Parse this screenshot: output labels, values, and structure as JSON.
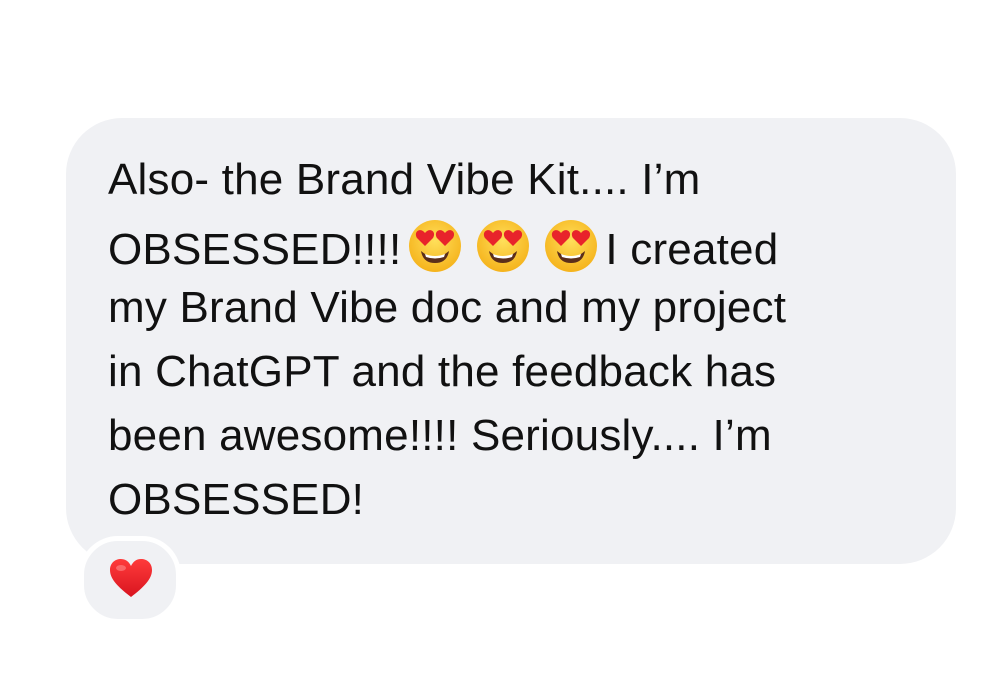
{
  "message": {
    "line1": "Also- the Brand  Vibe Kit.... I’m",
    "line2_before": "OBSESSED!!!!",
    "line2_after": "I created",
    "line3": "my Brand Vibe doc and my project",
    "line4": "in ChatGPT and the feedback has",
    "line5": "been awesome!!!! Seriously.... I’m",
    "line6": "OBSESSED!",
    "emojis": [
      "heart-eyes-emoji",
      "heart-eyes-emoji",
      "heart-eyes-emoji"
    ]
  },
  "reaction": {
    "icon": "red-heart-icon",
    "color": "#e8232b"
  },
  "colors": {
    "bubble": "#f0f1f4",
    "text": "#111111",
    "background": "#ffffff"
  }
}
